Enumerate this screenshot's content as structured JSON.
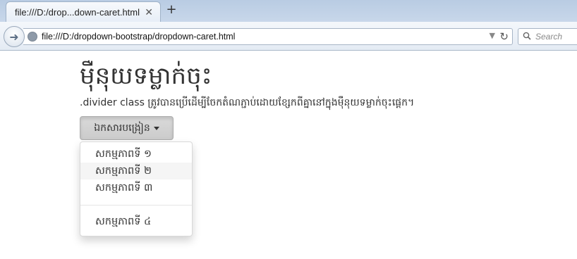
{
  "browser": {
    "tab_title": "file:///D:/drop...down-caret.html",
    "tab_close": "✕",
    "new_tab": "+",
    "url": "file:///D:/dropdown-bootstrap/dropdown-caret.html",
    "search_placeholder": "Search",
    "back_icon": "arrow-left-icon",
    "reload_icon": "reload-icon"
  },
  "page": {
    "heading": "ម៉ឺនុយទម្លាក់ចុះ",
    "description": ".divider class ត្រូវបានប្រើដើម្បីចែកតំណភ្ជាប់ដោយខ្សែកពីគ្នានៅក្នុងម៉ឺនុយទម្លាក់ចុះផ្ដេក។",
    "dropdown_label": "ឯកសារបង្រៀន",
    "menu_items": [
      "សកម្មភាពទី ១",
      "សកម្មភាពទី ២",
      "សកម្មភាពទី ៣",
      "សកម្មភាពទី ៤"
    ],
    "hovered_item_index": 1
  }
}
